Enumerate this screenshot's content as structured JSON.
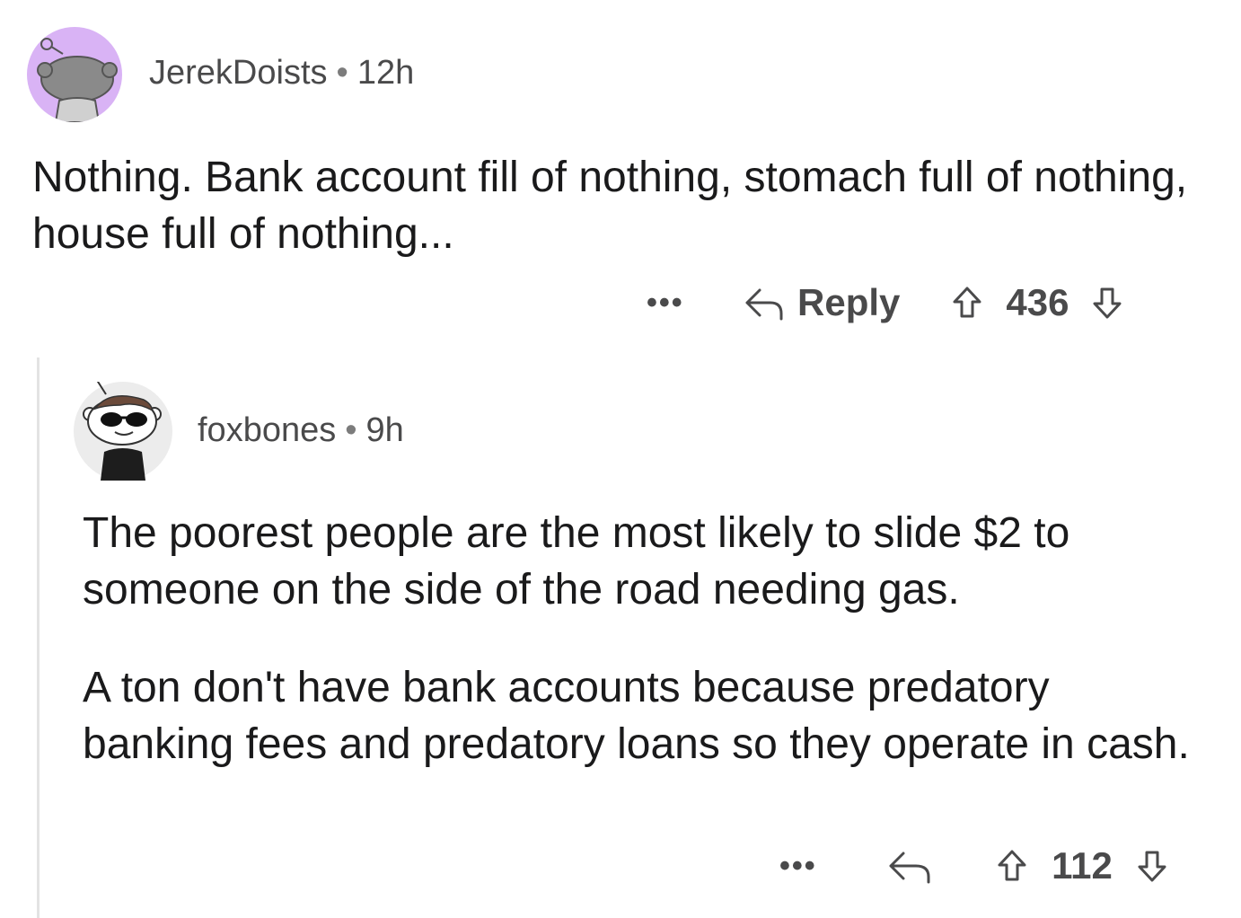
{
  "comments": [
    {
      "author": "JerekDoists",
      "separator": "•",
      "time": "12h",
      "body": [
        "Nothing. Bank account fill of nothing, stomach full of nothing, house full of nothing..."
      ],
      "actions": {
        "more": "•••",
        "reply_label": "Reply",
        "votes": "436"
      },
      "avatar_bg": "#d9b3f5"
    },
    {
      "author": "foxbones",
      "separator": "•",
      "time": "9h",
      "body": [
        "The poorest people are the most likely to slide $2 to someone on the side of the road needing gas.",
        "A ton don't have bank accounts because predatory banking fees and predatory loans so they operate in cash."
      ],
      "actions": {
        "more": "•••",
        "reply_label": "",
        "votes": "112"
      },
      "avatar_bg": "#ececec"
    }
  ],
  "icons": {
    "reply": "reply-arrow-icon",
    "upvote": "upvote-arrow-icon",
    "downvote": "downvote-arrow-icon",
    "more": "more-options-icon"
  },
  "colors": {
    "text": "#1a1a1b",
    "meta": "#4a4a4b",
    "thread_line": "#e3e3e3"
  }
}
